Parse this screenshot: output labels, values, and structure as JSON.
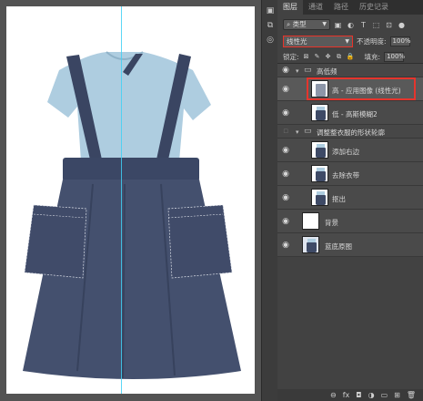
{
  "tabs": [
    "图层",
    "通道",
    "路径",
    "历史记录"
  ],
  "filter": {
    "kind": "类型"
  },
  "blend": {
    "mode": "线性光",
    "opacity_label": "不透明度:",
    "opacity_value": "100%",
    "lock_label": "锁定:",
    "fill_label": "填充:",
    "fill_value": "100%"
  },
  "layers": [
    {
      "name": "高低频",
      "type": "group",
      "expanded": true,
      "visible": true
    },
    {
      "name": "高 - 应用图像 (线性光)",
      "type": "layer",
      "visible": true,
      "selected": true
    },
    {
      "name": "低 - 高斯模糊2",
      "type": "layer",
      "visible": true
    },
    {
      "name": "调整整衣服的形状轮廓",
      "type": "group",
      "expanded": true,
      "visible": false
    },
    {
      "name": "添加右边",
      "type": "layer",
      "visible": true
    },
    {
      "name": "去除衣带",
      "type": "layer",
      "visible": true
    },
    {
      "name": "抠出",
      "type": "layer",
      "visible": true
    },
    {
      "name": "背景",
      "type": "layer",
      "visible": true
    },
    {
      "name": "蓝底原图",
      "type": "layer",
      "visible": true
    }
  ],
  "bottom_icons": [
    "link-icon",
    "fx-icon",
    "mask-icon",
    "adjustment-icon",
    "folder-icon",
    "new-layer-icon",
    "trash-icon"
  ],
  "bottom_glyphs": [
    "⊖",
    "fx",
    "◘",
    "◑",
    "▭",
    "⊞",
    "🗑"
  ],
  "strip_glyphs": [
    "▣",
    "⧉",
    "◎"
  ],
  "colors": {
    "selection_outline": "#e5352d",
    "guide": "#3fd0f4",
    "dress_navy": "#3e4a66",
    "shirt_blue": "#aecde0"
  }
}
